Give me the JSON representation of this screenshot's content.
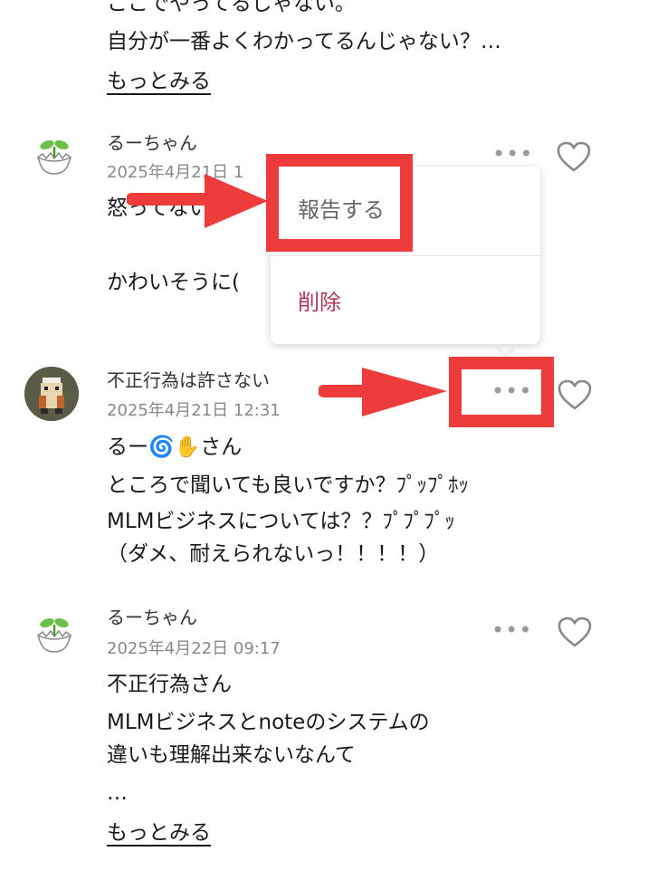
{
  "comments": [
    {
      "lines": [
        "ここでやってるじゃない。",
        "自分が一番よくわかってるんじゃない？…"
      ],
      "more_link": "もっとみる"
    },
    {
      "author": "るーちゃん",
      "date": "2025年4月21日 1",
      "lines": [
        "怒ってない",
        "",
        "かわいそうに("
      ]
    },
    {
      "author": "不正行為は許さない",
      "date": "2025年4月21日 12:31",
      "lines": [
        "るー🌀✋さん",
        "ところで聞いても良いですか？ﾌﾟｯﾌﾟﾎｯ",
        "MLMビジネスについては？？ﾌﾟﾌﾟﾌﾟｯ",
        "（ダメ、耐えられないっ！！！！）"
      ]
    },
    {
      "author": "るーちゃん",
      "date": "2025年4月22日 09:17",
      "lines": [
        "不正行為さん",
        "MLMビジネスとnoteのシステムの",
        "違いも理解出来ないなんて",
        "…"
      ],
      "more_link": "もっとみる"
    }
  ],
  "context_menu": {
    "report_label": "報告する",
    "delete_label": "削除"
  },
  "icons": {
    "more": "•••",
    "like": "heart-outline-icon",
    "avatar_sprout": "sprout-icon"
  },
  "colors": {
    "annotation_red": "#ee3b3b",
    "delete_text": "#b0395a"
  }
}
